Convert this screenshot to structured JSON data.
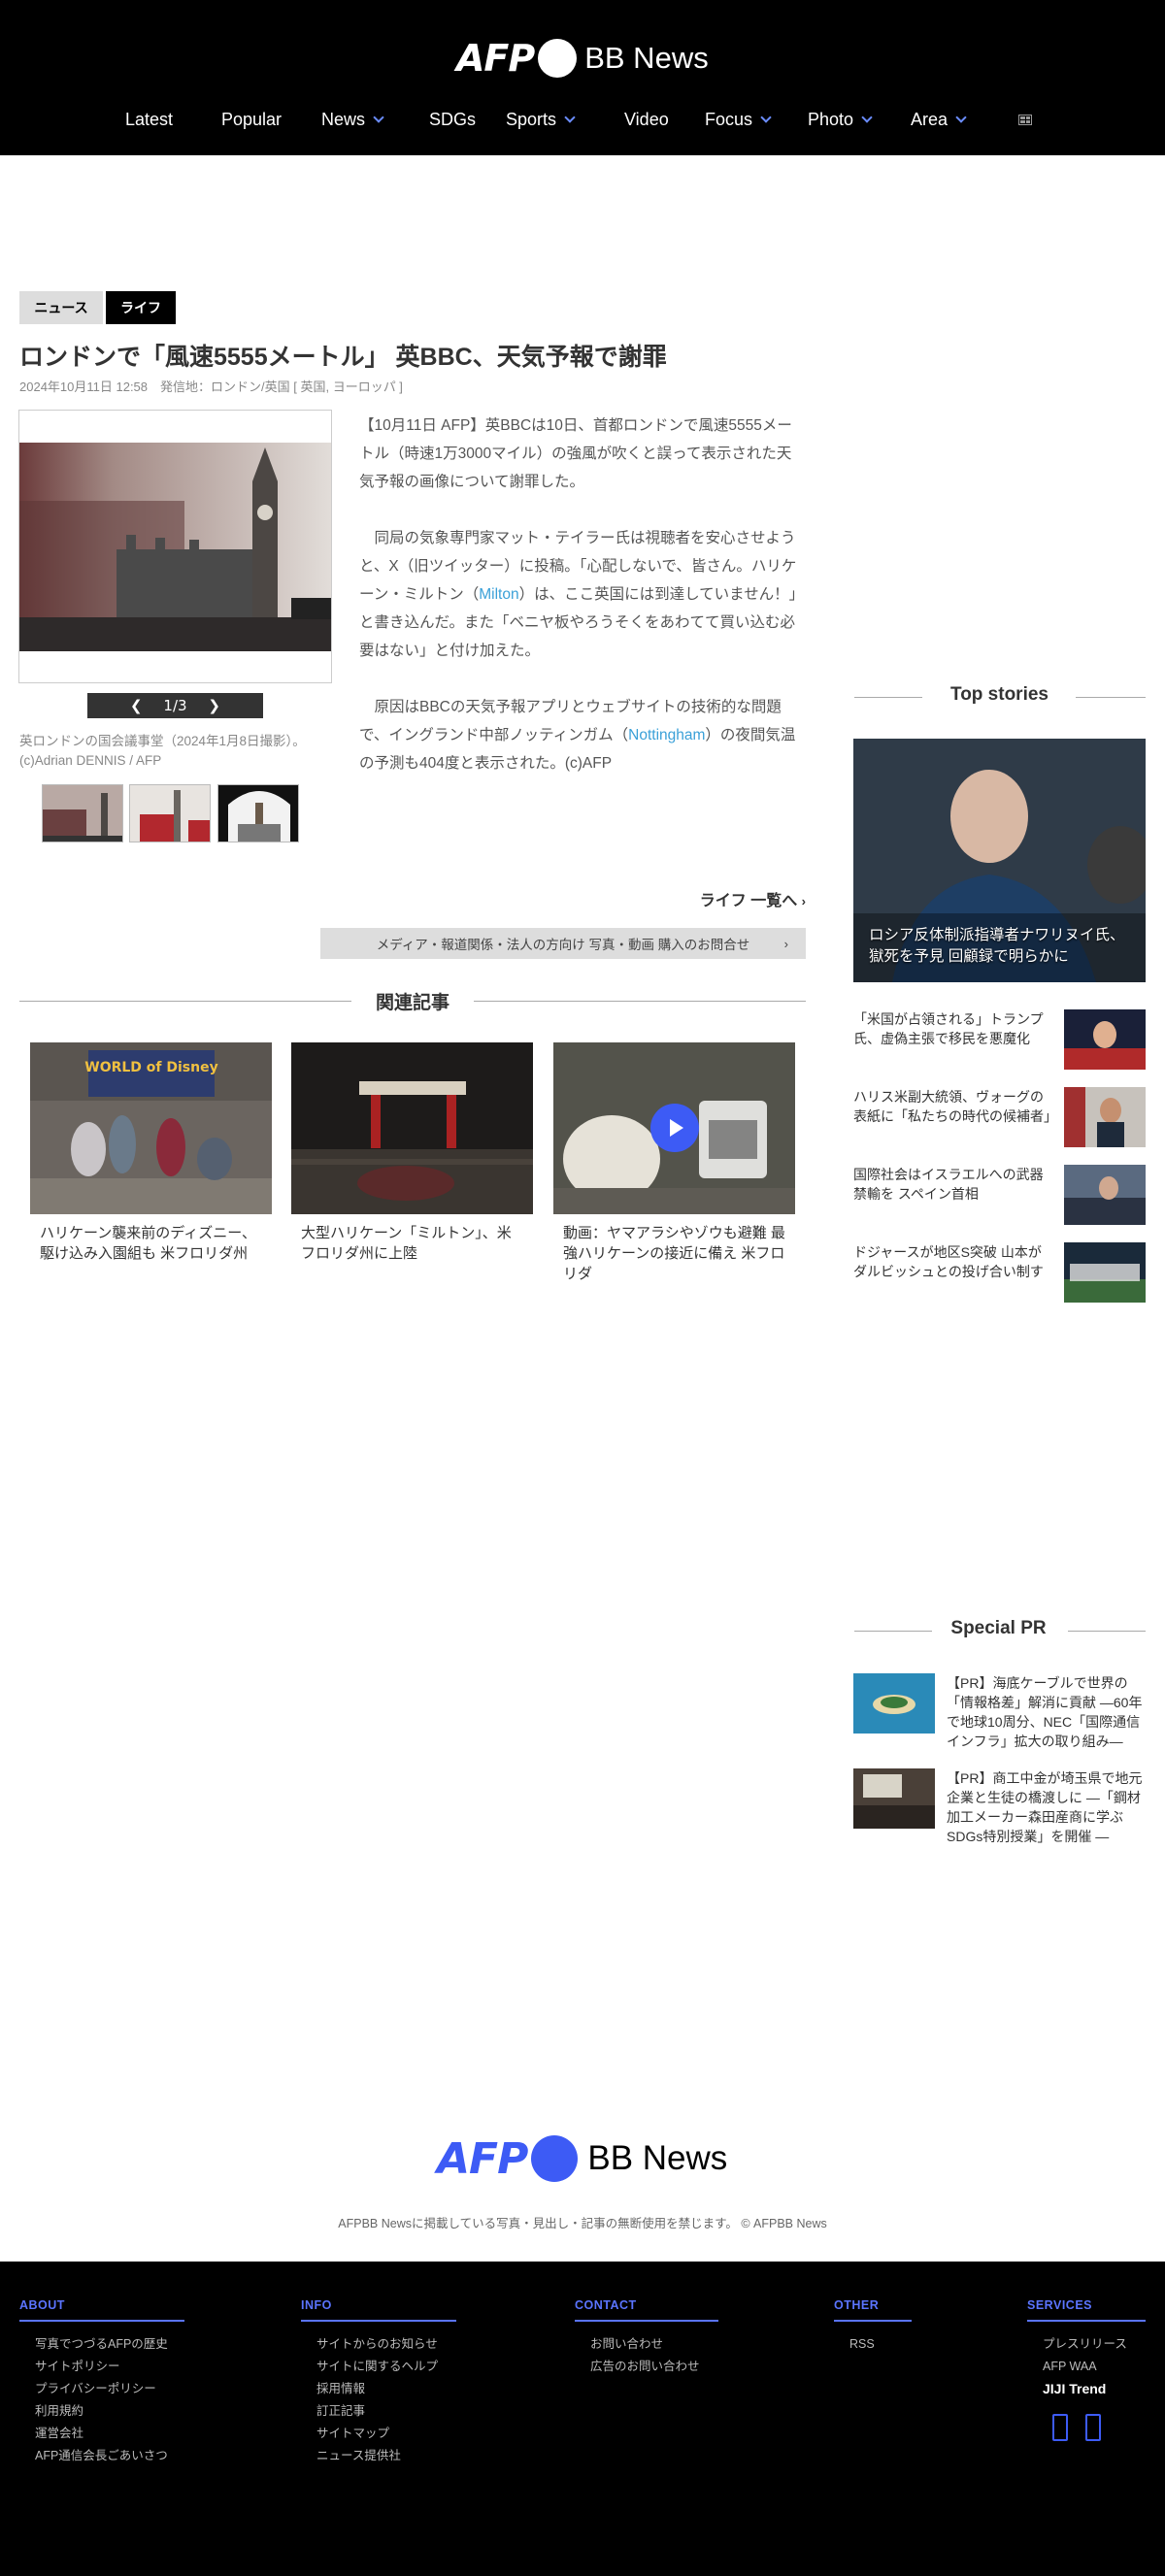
{
  "header": {
    "logo_afp": "AFP",
    "logo_bb": "BB News",
    "nav": [
      {
        "label": "Latest",
        "dropdown": false
      },
      {
        "label": "Popular",
        "dropdown": false
      },
      {
        "label": "News",
        "dropdown": true
      },
      {
        "label": "SDGs",
        "dropdown": false
      },
      {
        "label": "Sports",
        "dropdown": true
      },
      {
        "label": "Video",
        "dropdown": false
      },
      {
        "label": "Focus",
        "dropdown": true
      },
      {
        "label": "Photo",
        "dropdown": true
      },
      {
        "label": "Area",
        "dropdown": true
      }
    ]
  },
  "article": {
    "tags": [
      "ニュース",
      "ライフ"
    ],
    "headline": "ロンドンで「風速5555メートル」 英BBC、天気予報で謝罪",
    "meta": "2024年10月11日 12:58　発信地：ロンドン/英国 [ 英国, ヨーロッパ ]",
    "gallery": {
      "pager": "1/3",
      "prev": "❮",
      "next": "❯",
      "caption": "英ロンドンの国会議事堂（2024年1月8日撮影）。(c)Adrian DENNIS / AFP",
      "photo_credit": "AFP/Adrian DENNIS"
    },
    "para1": "【10月11日 AFP】英BBCは10日、首都ロンドンで風速5555メートル（時速1万3000マイル）の強風が吹くと誤って表示された天気予報の画像について謝罪した。",
    "para2_a": "　同局の気象専門家マット・テイラー氏は視聴者を安心させようと、X（旧ツイッター）に投稿。「心配しないで、皆さん。ハリケーン・ミルトン（",
    "para2_link": "Milton",
    "para2_b": "）は、ここ英国には到達していません！」と書き込んだ。また「ベニヤ板やろうそくをあわてて買い込む必要はない」と付け加えた。",
    "para3_a": "　原因はBBCの天気予報アプリとウェブサイトの技術的な問題で、イングランド中部ノッティンガム（",
    "para3_link": "Nottingham",
    "para3_b": "）の夜間気温の予測も404度と表示された。(c)AFP",
    "life_more": "ライフ 一覧へ",
    "purchase": "メディア・報道関係・法人の方向け 写真・動画 購入のお問合せ"
  },
  "related": {
    "title": "関連記事",
    "items": [
      {
        "title": "ハリケーン襲来前のディズニー、駆け込み入園組も 米フロリダ州",
        "sign": "WORLD of Disney"
      },
      {
        "title": "大型ハリケーン「ミルトン」、米フロリダ州に上陸"
      },
      {
        "title": "動画：ヤマアラシやゾウも避難 最強ハリケーンの接近に備え 米フロリダ"
      }
    ]
  },
  "sidebar": {
    "top_stories_title": "Top stories",
    "feature_title": "ロシア反体制派指導者ナワリヌイ氏、獄死を予見 回顧録で明らかに",
    "stories": [
      {
        "title": "「米国が占領される」トランプ氏、虚偽主張で移民を悪魔化"
      },
      {
        "title": "ハリス米副大統領、ヴォーグの表紙に「私たちの時代の候補者」"
      },
      {
        "title": "国際社会はイスラエルへの武器禁輸を スペイン首相"
      },
      {
        "title": "ドジャースが地区S突破 山本がダルビッシュとの投げ合い制す"
      }
    ],
    "special_pr_title": "Special PR",
    "pr": [
      {
        "title": "【PR】海底ケーブルで世界の「情報格差」解消に貢献 ―60年で地球10周分、NEC「国際通信インフラ」拡大の取り組み―"
      },
      {
        "title": "【PR】商工中金が埼玉県で地元企業と生徒の橋渡しに ―「鋼材加工メーカー森田産商に学ぶSDGs特別授業」を開催 ―"
      }
    ]
  },
  "footer": {
    "logo_afp": "AFP",
    "logo_bb": "BB News",
    "copyright": "AFPBB Newsに掲載している写真・見出し・記事の無断使用を禁じます。 © AFPBB News",
    "columns": [
      {
        "head": "ABOUT",
        "links": [
          "写真でつづるAFPの歴史",
          "サイトポリシー",
          "プライバシーポリシー",
          "利用規約",
          "運営会社",
          "AFP通信会長ごあいさつ"
        ]
      },
      {
        "head": "INFO",
        "links": [
          "サイトからのお知らせ",
          "サイトに関するヘルプ",
          "採用情報",
          "訂正記事",
          "サイトマップ",
          "ニュース提供社"
        ]
      },
      {
        "head": "CONTACT",
        "links": [
          "お問い合わせ",
          "広告のお問い合わせ"
        ]
      },
      {
        "head": "OTHER",
        "links": [
          "RSS"
        ]
      },
      {
        "head": "SERVICES",
        "links": [
          "プレスリリース",
          "AFP WAA",
          "JIJI Trend"
        ]
      }
    ]
  },
  "colors": {
    "accent": "#3d5bf5",
    "link": "#3aa0d8",
    "header_bg": "#000000"
  }
}
